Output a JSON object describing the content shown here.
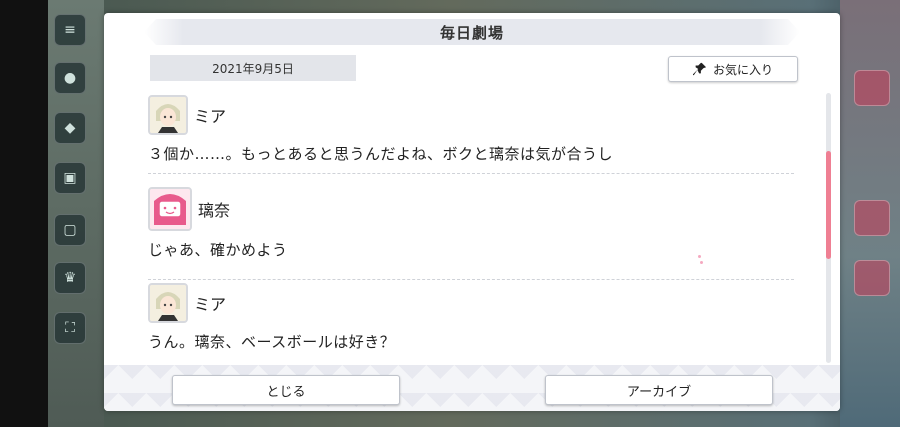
{
  "dialog": {
    "title": "毎日劇場",
    "date": "2021年9月5日",
    "favorite_label": "お気に入り"
  },
  "messages": [
    {
      "speaker": "ミア",
      "text": "３個か……。もっとあると思うんだよね、ボクと璃奈は気が合うし",
      "avatar": "mia-avatar"
    },
    {
      "speaker": "璃奈",
      "text": "じゃあ、確かめよう",
      "avatar": "rina-avatar"
    },
    {
      "speaker": "ミア",
      "text": "うん。璃奈、ベースボールは好き？",
      "avatar": "mia-avatar"
    }
  ],
  "footer": {
    "close_label": "とじる",
    "archive_label": "アーカイブ"
  },
  "colors": {
    "accent_pink": "#ef7f93",
    "title_bg": "#e6e8ee",
    "date_bg": "#e3e5ea"
  }
}
